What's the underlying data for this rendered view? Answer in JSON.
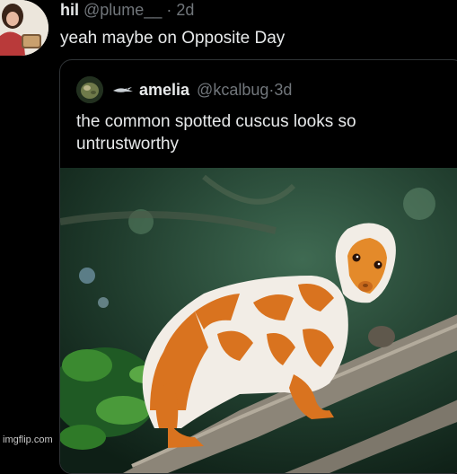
{
  "tweet": {
    "display_name": "hil",
    "handle": "@plume__",
    "separator": "·",
    "time": "2d",
    "text": "yeah maybe on Opposite Day"
  },
  "quote": {
    "display_name": "amelia",
    "handle": "@kcalbug",
    "separator": "·",
    "time": "3d",
    "text": "the common spotted cuscus looks so untrustworthy",
    "image_subject": "common spotted cuscus on a tree branch"
  },
  "watermark": "imgflip.com",
  "colors": {
    "background": "#000000",
    "text_primary": "#e7e9ea",
    "text_secondary": "#71767b",
    "border": "#2f3336",
    "cuscus_orange": "#d9731f",
    "cuscus_white": "#f2ede6"
  }
}
